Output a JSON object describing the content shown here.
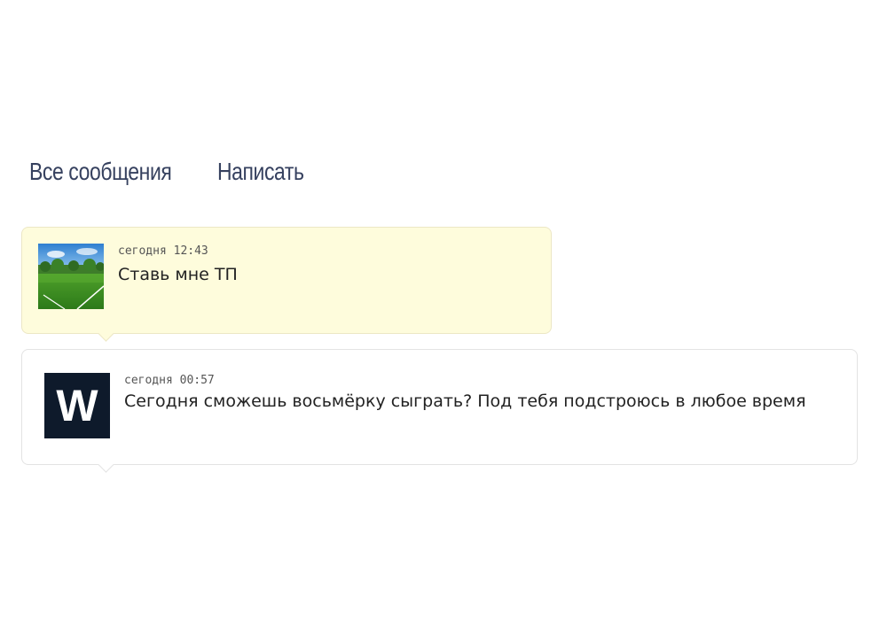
{
  "nav": {
    "all_messages": "Все сообщения",
    "write": "Написать"
  },
  "messages": [
    {
      "time": "сегодня 12:43",
      "text": "Ставь мне ТП",
      "avatar_icon": "football-field-photo",
      "background": "#fefcdc"
    },
    {
      "time": "сегодня 00:57",
      "text": "Сегодня сможешь восьмёрку сыграть? Под тебя подстроюсь в любое время",
      "avatar_icon": "w-logo",
      "avatar_letter": "W",
      "background": "#ffffff"
    }
  ],
  "colors": {
    "nav_text": "#36415f",
    "highlight_bg": "#fefcdc",
    "avatar_dark": "#0e1a2b"
  }
}
